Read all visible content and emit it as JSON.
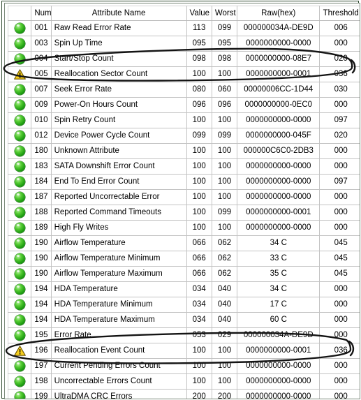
{
  "table": {
    "columns": [
      {
        "key": "status",
        "label": ""
      },
      {
        "key": "num",
        "label": "Num"
      },
      {
        "key": "name",
        "label": "Attribute Name"
      },
      {
        "key": "value",
        "label": "Value"
      },
      {
        "key": "worst",
        "label": "Worst"
      },
      {
        "key": "raw",
        "label": "Raw(hex)"
      },
      {
        "key": "threshold",
        "label": "Threshold"
      }
    ],
    "rows": [
      {
        "status": "green-led-icon",
        "num": "001",
        "name": "Raw Read Error Rate",
        "value": "113",
        "worst": "099",
        "raw": "000000034A-DE9D",
        "threshold": "006"
      },
      {
        "status": "green-led-icon",
        "num": "003",
        "name": "Spin Up Time",
        "value": "095",
        "worst": "095",
        "raw": "0000000000-0000",
        "threshold": "000"
      },
      {
        "status": "green-led-icon",
        "num": "004",
        "name": "Start/Stop Count",
        "value": "098",
        "worst": "098",
        "raw": "0000000000-08E7",
        "threshold": "020"
      },
      {
        "status": "warning-triangle-icon",
        "num": "005",
        "name": "Reallocation Sector Count",
        "value": "100",
        "worst": "100",
        "raw": "0000000000-0001",
        "threshold": "036"
      },
      {
        "status": "green-led-icon",
        "num": "007",
        "name": "Seek Error Rate",
        "value": "080",
        "worst": "060",
        "raw": "00000006CC-1D44",
        "threshold": "030"
      },
      {
        "status": "green-led-icon",
        "num": "009",
        "name": "Power-On Hours Count",
        "value": "096",
        "worst": "096",
        "raw": "0000000000-0EC0",
        "threshold": "000"
      },
      {
        "status": "green-led-icon",
        "num": "010",
        "name": "Spin Retry Count",
        "value": "100",
        "worst": "100",
        "raw": "0000000000-0000",
        "threshold": "097"
      },
      {
        "status": "green-led-icon",
        "num": "012",
        "name": "Device Power Cycle Count",
        "value": "099",
        "worst": "099",
        "raw": "0000000000-045F",
        "threshold": "020"
      },
      {
        "status": "green-led-icon",
        "num": "180",
        "name": "Unknown Attribute",
        "value": "100",
        "worst": "100",
        "raw": "000000C6C0-2DB3",
        "threshold": "000"
      },
      {
        "status": "green-led-icon",
        "num": "183",
        "name": "SATA Downshift Error Count",
        "value": "100",
        "worst": "100",
        "raw": "0000000000-0000",
        "threshold": "000"
      },
      {
        "status": "green-led-icon",
        "num": "184",
        "name": "End To End Error Count",
        "value": "100",
        "worst": "100",
        "raw": "0000000000-0000",
        "threshold": "097"
      },
      {
        "status": "green-led-icon",
        "num": "187",
        "name": "Reported Uncorrectable Error",
        "value": "100",
        "worst": "100",
        "raw": "0000000000-0000",
        "threshold": "000"
      },
      {
        "status": "green-led-icon",
        "num": "188",
        "name": "Reported Command Timeouts",
        "value": "100",
        "worst": "099",
        "raw": "0000000000-0001",
        "threshold": "000"
      },
      {
        "status": "green-led-icon",
        "num": "189",
        "name": "High Fly Writes",
        "value": "100",
        "worst": "100",
        "raw": "0000000000-0000",
        "threshold": "000"
      },
      {
        "status": "green-led-icon",
        "num": "190",
        "name": "Airflow Temperature",
        "value": "066",
        "worst": "062",
        "raw": "34 C",
        "threshold": "045"
      },
      {
        "status": "green-led-icon",
        "num": "190",
        "name": "Airflow Temperature Minimum",
        "value": "066",
        "worst": "062",
        "raw": "33 C",
        "threshold": "045"
      },
      {
        "status": "green-led-icon",
        "num": "190",
        "name": "Airflow Temperature Maximum",
        "value": "066",
        "worst": "062",
        "raw": "35 C",
        "threshold": "045"
      },
      {
        "status": "green-led-icon",
        "num": "194",
        "name": "HDA Temperature",
        "value": "034",
        "worst": "040",
        "raw": "34 C",
        "threshold": "000"
      },
      {
        "status": "green-led-icon",
        "num": "194",
        "name": "HDA Temperature Minimum",
        "value": "034",
        "worst": "040",
        "raw": "17 C",
        "threshold": "000"
      },
      {
        "status": "green-led-icon",
        "num": "194",
        "name": "HDA Temperature Maximum",
        "value": "034",
        "worst": "040",
        "raw": "60 C",
        "threshold": "000"
      },
      {
        "status": "green-led-icon",
        "num": "195",
        "name": "Error Rate",
        "value": "053",
        "worst": "029",
        "raw": "000000034A-DE9D",
        "threshold": "000"
      },
      {
        "status": "warning-triangle-icon",
        "num": "196",
        "name": "Reallocation Event Count",
        "value": "100",
        "worst": "100",
        "raw": "0000000000-0001",
        "threshold": "036"
      },
      {
        "status": "green-led-icon",
        "num": "197",
        "name": "Current Pending Errors Count",
        "value": "100",
        "worst": "100",
        "raw": "0000000000-0000",
        "threshold": "000"
      },
      {
        "status": "green-led-icon",
        "num": "198",
        "name": "Uncorrectable Errors Count",
        "value": "100",
        "worst": "100",
        "raw": "0000000000-0000",
        "threshold": "000"
      },
      {
        "status": "green-led-icon",
        "num": "199",
        "name": "UltraDMA CRC Errors",
        "value": "200",
        "worst": "200",
        "raw": "0000000000-0000",
        "threshold": "000"
      }
    ]
  },
  "annotations": [
    {
      "name": "highlight-ellipse-row-005",
      "target_row_num": "005",
      "shape": "hand-drawn-ellipse",
      "color": "#111111"
    },
    {
      "name": "highlight-ellipse-row-196",
      "target_row_num": "196",
      "shape": "hand-drawn-ellipse",
      "color": "#111111"
    }
  ],
  "colors": {
    "ok_status": "#2aa81a",
    "warn_status": "#f5c518",
    "grid": "#c3c3c3",
    "frame": "#2e4a2e",
    "text": "#000000"
  }
}
